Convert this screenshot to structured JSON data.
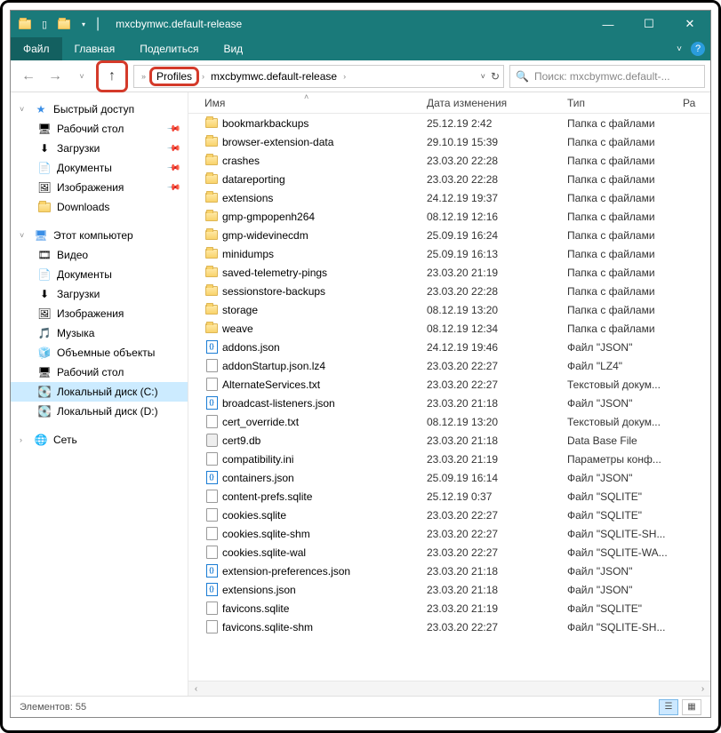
{
  "title": "mxcbymwc.default-release",
  "menu": {
    "file": "Файл",
    "home": "Главная",
    "share": "Поделиться",
    "view": "Вид"
  },
  "breadcrumb": {
    "profiles": "Profiles",
    "current": "mxcbymwc.default-release"
  },
  "search_placeholder": "Поиск: mxcbymwc.default-...",
  "columns": {
    "name": "Имя",
    "date": "Дата изменения",
    "type": "Тип",
    "size": "Ра"
  },
  "sidebar": {
    "quick": {
      "label": "Быстрый доступ",
      "items": [
        {
          "label": "Рабочий стол",
          "icon": "desktop",
          "pinned": true
        },
        {
          "label": "Загрузки",
          "icon": "downloads",
          "pinned": true
        },
        {
          "label": "Документы",
          "icon": "documents",
          "pinned": true
        },
        {
          "label": "Изображения",
          "icon": "pictures",
          "pinned": true
        },
        {
          "label": "Downloads",
          "icon": "folder",
          "pinned": false
        }
      ]
    },
    "pc": {
      "label": "Этот компьютер",
      "items": [
        {
          "label": "Видео",
          "icon": "videos"
        },
        {
          "label": "Документы",
          "icon": "documents"
        },
        {
          "label": "Загрузки",
          "icon": "downloads"
        },
        {
          "label": "Изображения",
          "icon": "pictures"
        },
        {
          "label": "Музыка",
          "icon": "music"
        },
        {
          "label": "Объемные объекты",
          "icon": "3d"
        },
        {
          "label": "Рабочий стол",
          "icon": "desktop"
        },
        {
          "label": "Локальный диск (C:)",
          "icon": "drive",
          "selected": true
        },
        {
          "label": "Локальный диск (D:)",
          "icon": "drive"
        }
      ]
    },
    "net": {
      "label": "Сеть"
    }
  },
  "files": [
    {
      "name": "bookmarkbackups",
      "date": "25.12.19 2:42",
      "type": "Папка с файлами",
      "icon": "folder"
    },
    {
      "name": "browser-extension-data",
      "date": "29.10.19 15:39",
      "type": "Папка с файлами",
      "icon": "folder"
    },
    {
      "name": "crashes",
      "date": "23.03.20 22:28",
      "type": "Папка с файлами",
      "icon": "folder"
    },
    {
      "name": "datareporting",
      "date": "23.03.20 22:28",
      "type": "Папка с файлами",
      "icon": "folder"
    },
    {
      "name": "extensions",
      "date": "24.12.19 19:37",
      "type": "Папка с файлами",
      "icon": "folder"
    },
    {
      "name": "gmp-gmpopenh264",
      "date": "08.12.19 12:16",
      "type": "Папка с файлами",
      "icon": "folder"
    },
    {
      "name": "gmp-widevinecdm",
      "date": "25.09.19 16:24",
      "type": "Папка с файлами",
      "icon": "folder"
    },
    {
      "name": "minidumps",
      "date": "25.09.19 16:13",
      "type": "Папка с файлами",
      "icon": "folder"
    },
    {
      "name": "saved-telemetry-pings",
      "date": "23.03.20 21:19",
      "type": "Папка с файлами",
      "icon": "folder"
    },
    {
      "name": "sessionstore-backups",
      "date": "23.03.20 22:28",
      "type": "Папка с файлами",
      "icon": "folder"
    },
    {
      "name": "storage",
      "date": "08.12.19 13:20",
      "type": "Папка с файлами",
      "icon": "folder"
    },
    {
      "name": "weave",
      "date": "08.12.19 12:34",
      "type": "Папка с файлами",
      "icon": "folder"
    },
    {
      "name": "addons.json",
      "date": "24.12.19 19:46",
      "type": "Файл \"JSON\"",
      "icon": "json"
    },
    {
      "name": "addonStartup.json.lz4",
      "date": "23.03.20 22:27",
      "type": "Файл \"LZ4\"",
      "icon": "file"
    },
    {
      "name": "AlternateServices.txt",
      "date": "23.03.20 22:27",
      "type": "Текстовый докум...",
      "icon": "file"
    },
    {
      "name": "broadcast-listeners.json",
      "date": "23.03.20 21:18",
      "type": "Файл \"JSON\"",
      "icon": "json"
    },
    {
      "name": "cert_override.txt",
      "date": "08.12.19 13:20",
      "type": "Текстовый докум...",
      "icon": "file"
    },
    {
      "name": "cert9.db",
      "date": "23.03.20 21:18",
      "type": "Data Base File",
      "icon": "db"
    },
    {
      "name": "compatibility.ini",
      "date": "23.03.20 21:19",
      "type": "Параметры конф...",
      "icon": "file"
    },
    {
      "name": "containers.json",
      "date": "25.09.19 16:14",
      "type": "Файл \"JSON\"",
      "icon": "json"
    },
    {
      "name": "content-prefs.sqlite",
      "date": "25.12.19 0:37",
      "type": "Файл \"SQLITE\"",
      "icon": "file"
    },
    {
      "name": "cookies.sqlite",
      "date": "23.03.20 22:27",
      "type": "Файл \"SQLITE\"",
      "icon": "file"
    },
    {
      "name": "cookies.sqlite-shm",
      "date": "23.03.20 22:27",
      "type": "Файл \"SQLITE-SH...",
      "icon": "file"
    },
    {
      "name": "cookies.sqlite-wal",
      "date": "23.03.20 22:27",
      "type": "Файл \"SQLITE-WA...",
      "icon": "file"
    },
    {
      "name": "extension-preferences.json",
      "date": "23.03.20 21:18",
      "type": "Файл \"JSON\"",
      "icon": "json"
    },
    {
      "name": "extensions.json",
      "date": "23.03.20 21:18",
      "type": "Файл \"JSON\"",
      "icon": "json"
    },
    {
      "name": "favicons.sqlite",
      "date": "23.03.20 21:19",
      "type": "Файл \"SQLITE\"",
      "icon": "file"
    },
    {
      "name": "favicons.sqlite-shm",
      "date": "23.03.20 22:27",
      "type": "Файл \"SQLITE-SH...",
      "icon": "file"
    }
  ],
  "status": {
    "count_label": "Элементов: 55"
  }
}
